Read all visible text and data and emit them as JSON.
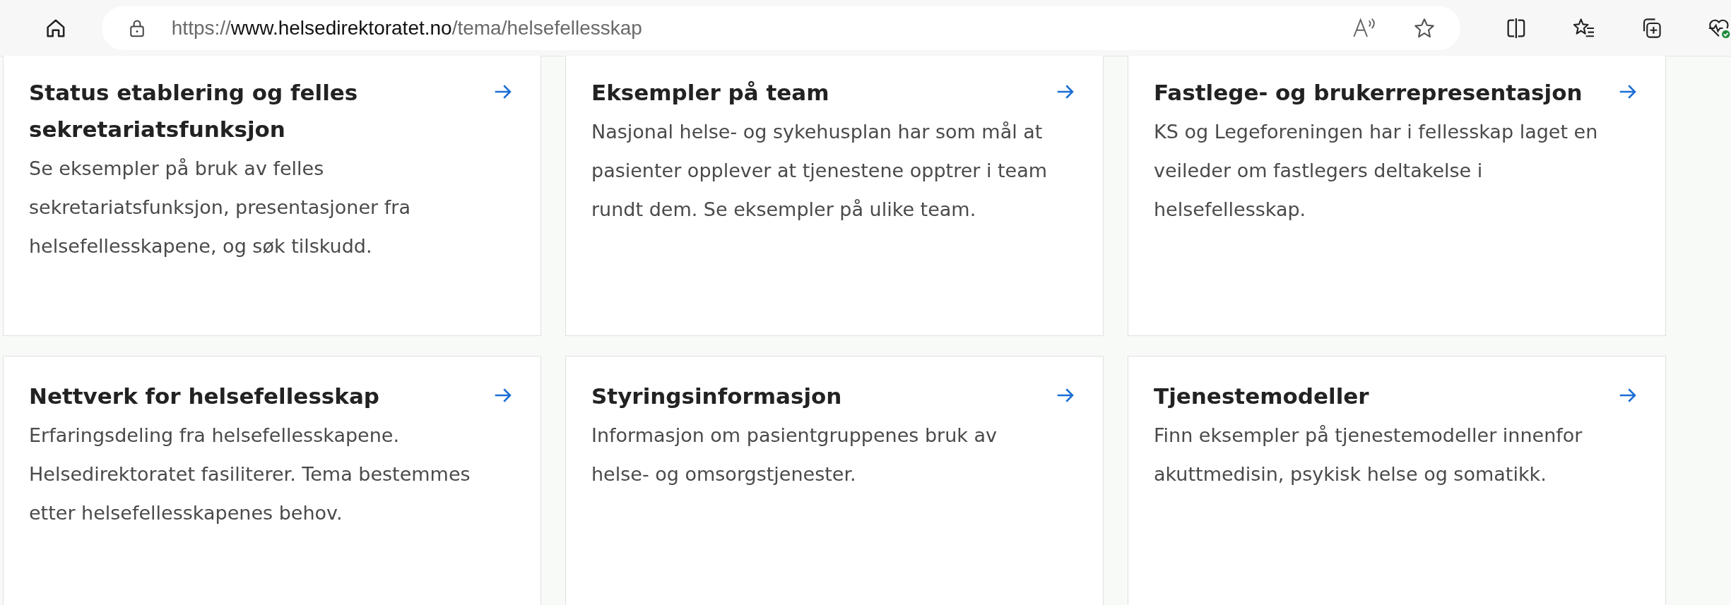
{
  "browser": {
    "url": {
      "scheme": "https://",
      "host": "www.helsedirektoratet.no",
      "path": "/tema/helsefellesskap"
    }
  },
  "cards": [
    {
      "title": "Status etablering og felles sekretariatsfunksjon",
      "text": "Se eksempler på bruk av felles sekretariatsfunksjon, presentasjoner fra helsefellesskapene, og søk tilskudd."
    },
    {
      "title": "Eksempler på team",
      "text": "Nasjonal helse- og sykehusplan har som mål at pasienter opplever at tjenestene opptrer i team rundt dem. Se eksempler på ulike team."
    },
    {
      "title": "Fastlege- og brukerrepresentasjon",
      "text": "KS og Legeforeningen har i fellesskap laget en veileder om fastlegers deltakelse i helsefellesskap."
    },
    {
      "title": "Nettverk for helsefellesskap",
      "text": "Erfaringsdeling fra helsefellesskapene. Helsedirektoratet fasiliterer. Tema bestemmes etter helsefellesskapenes behov."
    },
    {
      "title": "Styringsinformasjon",
      "text": "Informasjon om pasientgruppenes bruk av helse- og omsorgstjenester."
    },
    {
      "title": "Tjenestemodeller",
      "text": "Finn eksempler på tjenestemodeller innenfor akuttmedisin, psykisk helse og somatikk."
    }
  ]
}
